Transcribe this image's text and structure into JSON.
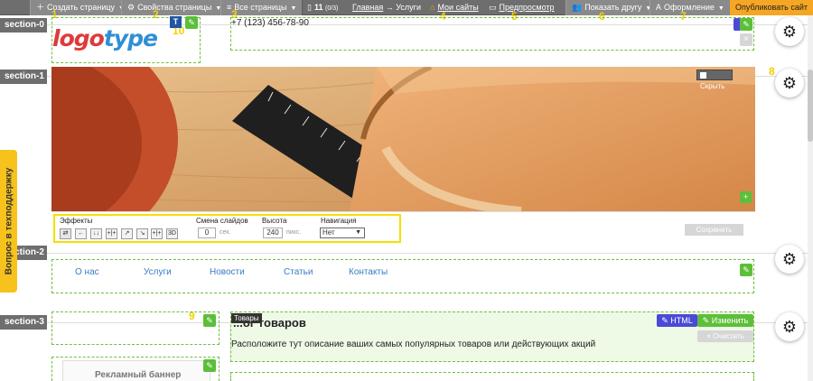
{
  "toolbar": {
    "create_page": "Создать страницу",
    "page_props": "Свойства страницы",
    "all_pages": "Все страницы",
    "page_num": "11",
    "page_count": "(0/3)",
    "breadcrumb_home": "Главная",
    "breadcrumb_arrow": "→",
    "breadcrumb_current": "Услуги",
    "my_sites": "Мои сайты",
    "preview": "Предпросмотр",
    "show_friend": "Показать другу",
    "design": "Оформление",
    "publish": "Опубликовать сайт"
  },
  "markers": [
    "1",
    "2",
    "3",
    "4",
    "5",
    "6",
    "7",
    "8",
    "9",
    "10",
    "11",
    "12"
  ],
  "sections": [
    "section-0",
    "section-1",
    "section-2",
    "section-3"
  ],
  "header": {
    "logo_part1": "logo",
    "logo_part2": "type",
    "phone": "+7 (123) 456-78-90"
  },
  "hero": {
    "hide_label": "Скрыть"
  },
  "effects": {
    "effects_label": "Эффекты",
    "slide_change_label": "Смена слайдов",
    "slide_change_value": "0",
    "slide_change_unit": "сек.",
    "height_label": "Высота",
    "height_value": "240",
    "height_unit": "пикс.",
    "nav_label": "Навигация",
    "nav_value": "Нет",
    "save_label": "Сохранить",
    "effect_buttons": [
      "⇄",
      "←",
      "↓↓",
      "+|+",
      "↗",
      "↘",
      "+|+",
      "3D"
    ]
  },
  "menu": {
    "items": [
      "О нас",
      "Услуги",
      "Новости",
      "Статьи",
      "Контакты"
    ]
  },
  "section3": {
    "tag": "Товары",
    "title": "...ог товаров",
    "text": "Расположите тут описание ваших самых популярных товаров или действующих акций",
    "html_btn": "HTML",
    "edit_btn": "Изменить",
    "clear_btn": "Очистить",
    "banner": "Рекламный баннер"
  },
  "support": "Вопрос в техподдержку",
  "colors": {
    "toolbar": "#6e6e6e",
    "publish": "#f5a623",
    "accent_green": "#5cbf3a",
    "marker_yellow": "#f1d000",
    "link_blue": "#3a7cc4"
  }
}
